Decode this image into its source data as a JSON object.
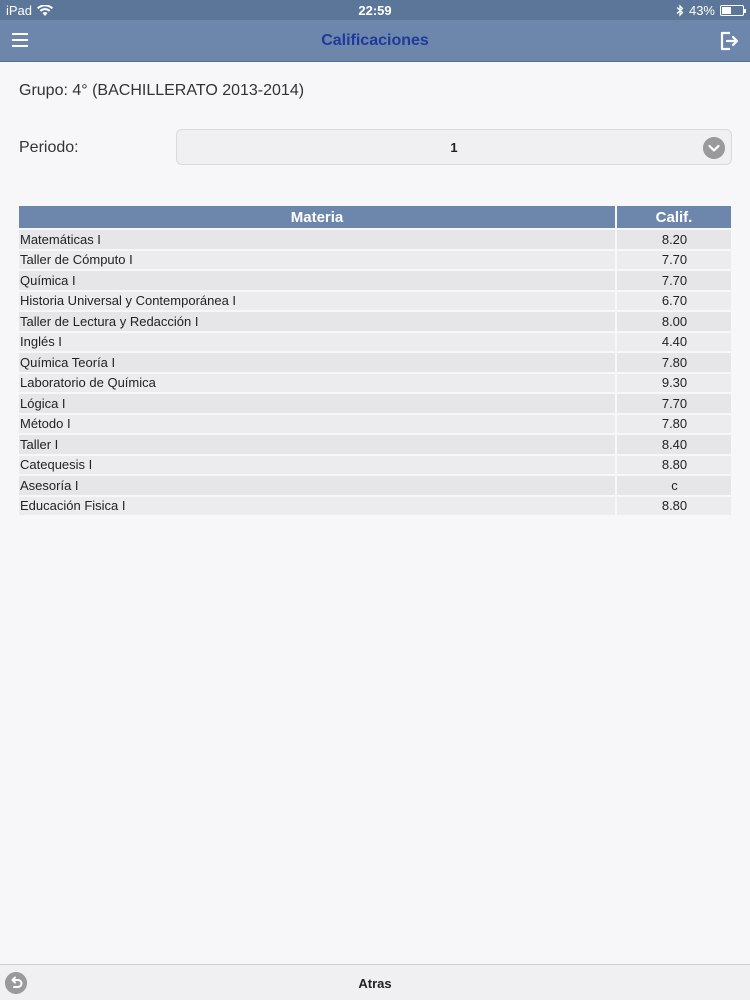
{
  "status_bar": {
    "device": "iPad",
    "time": "22:59",
    "battery": "43%"
  },
  "header": {
    "title": "Calificaciones"
  },
  "group_line": "Grupo: 4° (BACHILLERATO 2013-2014)",
  "period": {
    "label": "Periodo:",
    "value": "1"
  },
  "table": {
    "headers": [
      "Materia",
      "Calif."
    ],
    "rows": [
      {
        "subject": "Matemáticas I",
        "grade": "8.20"
      },
      {
        "subject": "Taller de Cómputo I",
        "grade": "7.70"
      },
      {
        "subject": "Química I",
        "grade": "7.70"
      },
      {
        "subject": "Historia Universal y Contemporánea I",
        "grade": "6.70"
      },
      {
        "subject": "Taller de Lectura y Redacción I",
        "grade": "8.00"
      },
      {
        "subject": "Inglés I",
        "grade": "4.40"
      },
      {
        "subject": "Química Teoría I",
        "grade": "7.80"
      },
      {
        "subject": "Laboratorio de Química",
        "grade": "9.30"
      },
      {
        "subject": "Lógica I",
        "grade": "7.70"
      },
      {
        "subject": "Método I",
        "grade": "7.80"
      },
      {
        "subject": "Taller I",
        "grade": "8.40"
      },
      {
        "subject": "Catequesis I",
        "grade": "8.80"
      },
      {
        "subject": "Asesoría I",
        "grade": "c"
      },
      {
        "subject": "Educación Fisica I",
        "grade": "8.80"
      }
    ]
  },
  "footer": {
    "back_label": "Atras"
  },
  "colors": {
    "header_bg": "#6d87ac",
    "title_color": "#1f3a9a",
    "row_bg": "#e6e6e9"
  },
  "icons": {
    "menu": "menu-icon",
    "logout": "logout-icon",
    "period_dropdown": "chevron-down-icon",
    "back": "back-arrow-icon",
    "wifi": "wifi-icon",
    "bluetooth": "bluetooth-icon",
    "battery": "battery-icon"
  }
}
